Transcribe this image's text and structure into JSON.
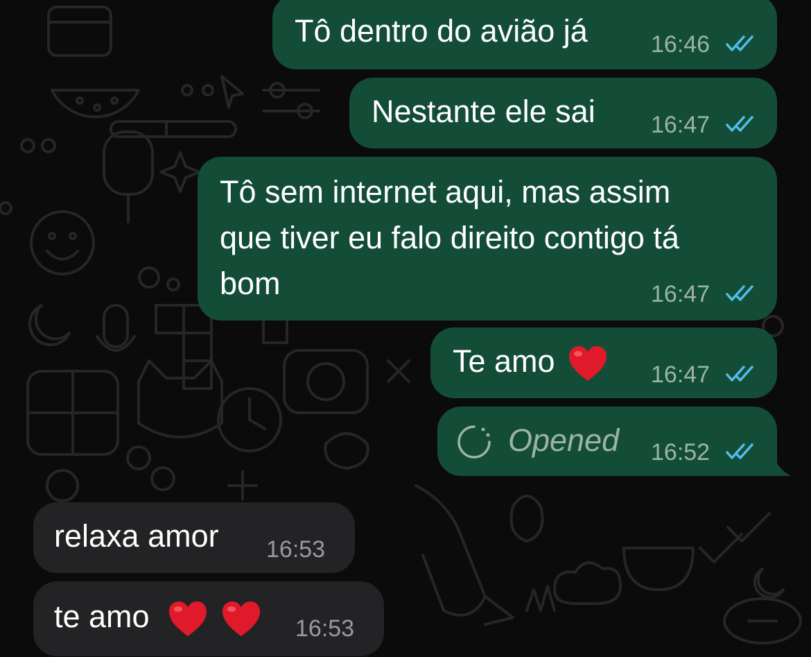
{
  "chat": {
    "messages": [
      {
        "direction": "outgoing",
        "text": "Tô dentro do avião já",
        "time": "16:46",
        "status": "read"
      },
      {
        "direction": "outgoing",
        "text": "Nestante ele sai",
        "time": "16:47",
        "status": "read"
      },
      {
        "direction": "outgoing",
        "lines": [
          "Tô sem internet aqui, mas assim",
          "que tiver eu falo direito contigo tá",
          "bom"
        ],
        "time": "16:47",
        "status": "read"
      },
      {
        "direction": "outgoing",
        "text": "Te amo",
        "emoji": "red-heart",
        "time": "16:47",
        "status": "read"
      },
      {
        "direction": "outgoing",
        "type": "view-once",
        "text": "Opened",
        "time": "16:52",
        "status": "read"
      },
      {
        "direction": "incoming",
        "text": "relaxa amor",
        "time": "16:53"
      },
      {
        "direction": "incoming",
        "text": "te amo",
        "emoji": "red-heart x2",
        "time": "16:53"
      }
    ]
  },
  "colors": {
    "background": "#0b0b0b",
    "outgoing_bubble": "#144d37",
    "incoming_bubble": "#232326",
    "read_ticks": "#53bdeb",
    "timestamp_outgoing": "#9cb3a8",
    "timestamp_incoming": "#9a9a9e",
    "heart": "#e0192b"
  },
  "icons": {
    "read_receipt": "double-check-icon",
    "view_once": "view-once-dashed-circle-icon",
    "heart": "red-heart-icon"
  }
}
